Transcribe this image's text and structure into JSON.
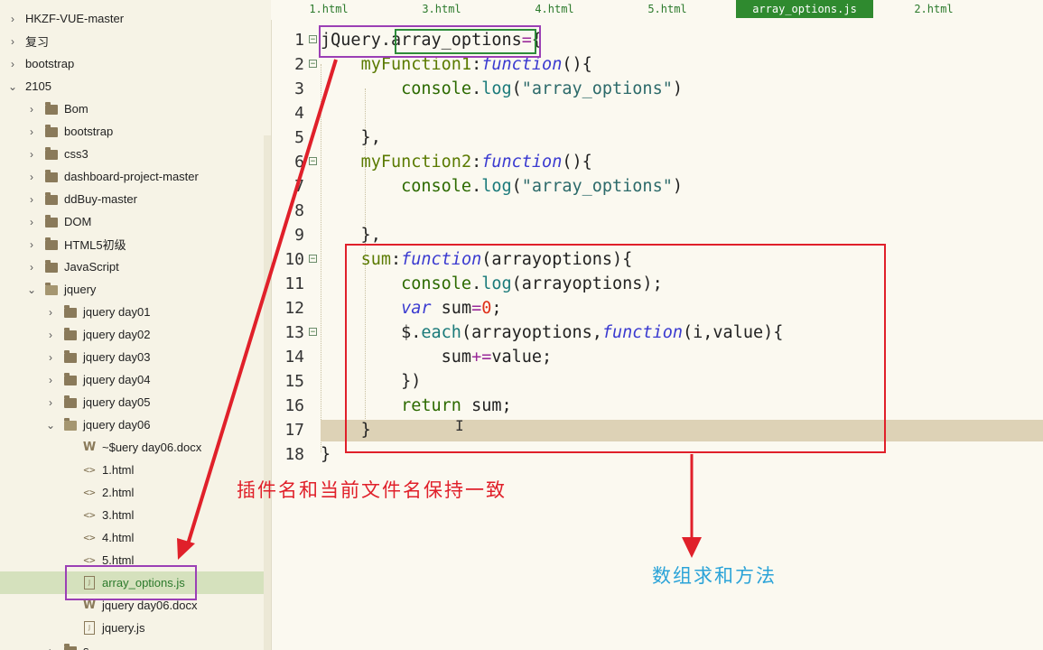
{
  "sidebar": {
    "items": [
      {
        "label": "HKZF-VUE-master",
        "depth": 0,
        "kind": "folder",
        "expanded": false
      },
      {
        "label": "复习",
        "depth": 0,
        "kind": "folder",
        "expanded": false
      },
      {
        "label": "bootstrap",
        "depth": 0,
        "kind": "folder",
        "expanded": false
      },
      {
        "label": "2105",
        "depth": 0,
        "kind": "folder",
        "expanded": true
      },
      {
        "label": "Bom",
        "depth": 1,
        "kind": "folder",
        "expanded": false
      },
      {
        "label": "bootstrap",
        "depth": 1,
        "kind": "folder",
        "expanded": false
      },
      {
        "label": "css3",
        "depth": 1,
        "kind": "folder",
        "expanded": false
      },
      {
        "label": "dashboard-project-master",
        "depth": 1,
        "kind": "folder",
        "expanded": false
      },
      {
        "label": "ddBuy-master",
        "depth": 1,
        "kind": "folder",
        "expanded": false
      },
      {
        "label": "DOM",
        "depth": 1,
        "kind": "folder",
        "expanded": false
      },
      {
        "label": "HTML5初级",
        "depth": 1,
        "kind": "folder",
        "expanded": false
      },
      {
        "label": "JavaScript",
        "depth": 1,
        "kind": "folder",
        "expanded": false
      },
      {
        "label": "jquery",
        "depth": 1,
        "kind": "folder",
        "expanded": true
      },
      {
        "label": "jquery day01",
        "depth": 2,
        "kind": "folder",
        "expanded": false
      },
      {
        "label": "jquery day02",
        "depth": 2,
        "kind": "folder",
        "expanded": false
      },
      {
        "label": "jquery day03",
        "depth": 2,
        "kind": "folder",
        "expanded": false
      },
      {
        "label": "jquery day04",
        "depth": 2,
        "kind": "folder",
        "expanded": false
      },
      {
        "label": "jquery day05",
        "depth": 2,
        "kind": "folder",
        "expanded": false
      },
      {
        "label": "jquery day06",
        "depth": 2,
        "kind": "folder",
        "expanded": true
      },
      {
        "label": "~$uery day06.docx",
        "depth": 3,
        "kind": "word"
      },
      {
        "label": "1.html",
        "depth": 3,
        "kind": "html"
      },
      {
        "label": "2.html",
        "depth": 3,
        "kind": "html"
      },
      {
        "label": "3.html",
        "depth": 3,
        "kind": "html"
      },
      {
        "label": "4.html",
        "depth": 3,
        "kind": "html"
      },
      {
        "label": "5.html",
        "depth": 3,
        "kind": "html"
      },
      {
        "label": "array_options.js",
        "depth": 3,
        "kind": "js",
        "active": true
      },
      {
        "label": "jquery day06.docx",
        "depth": 3,
        "kind": "word"
      },
      {
        "label": "jquery.js",
        "depth": 3,
        "kind": "js"
      },
      {
        "label": "s",
        "depth": 2,
        "kind": "folder",
        "expanded": false
      }
    ]
  },
  "tabs": [
    {
      "label": "1.html"
    },
    {
      "label": "3.html"
    },
    {
      "label": "4.html"
    },
    {
      "label": "5.html"
    },
    {
      "label": "array_options.js",
      "active": true
    },
    {
      "label": "2.html"
    }
  ],
  "code": {
    "lines": [
      {
        "n": "1",
        "fold": true,
        "tokens": [
          [
            "jQuery",
            "plain"
          ],
          [
            ".",
            "plain"
          ],
          [
            "array_options",
            "plain"
          ],
          [
            "=",
            "op"
          ],
          [
            "{",
            "plain"
          ]
        ]
      },
      {
        "n": "2",
        "fold": true,
        "tokens": [
          [
            "    ",
            "plain"
          ],
          [
            "myFunction1",
            "obj"
          ],
          [
            ":",
            "plain"
          ],
          [
            "function",
            "fn"
          ],
          [
            "(){",
            "plain"
          ]
        ]
      },
      {
        "n": "3",
        "fold": false,
        "tokens": [
          [
            "        ",
            "plain"
          ],
          [
            "console",
            "kw"
          ],
          [
            ".",
            "plain"
          ],
          [
            "log",
            "call"
          ],
          [
            "(",
            "plain"
          ],
          [
            "\"array_options\"",
            "str"
          ],
          [
            ")",
            "plain"
          ]
        ]
      },
      {
        "n": "4",
        "fold": false,
        "tokens": []
      },
      {
        "n": "5",
        "fold": false,
        "tokens": [
          [
            "    },",
            "plain"
          ]
        ]
      },
      {
        "n": "6",
        "fold": true,
        "tokens": [
          [
            "    ",
            "plain"
          ],
          [
            "myFunction2",
            "obj"
          ],
          [
            ":",
            "plain"
          ],
          [
            "function",
            "fn"
          ],
          [
            "(){",
            "plain"
          ]
        ]
      },
      {
        "n": "7",
        "fold": false,
        "tokens": [
          [
            "        ",
            "plain"
          ],
          [
            "console",
            "kw"
          ],
          [
            ".",
            "plain"
          ],
          [
            "log",
            "call"
          ],
          [
            "(",
            "plain"
          ],
          [
            "\"array_options\"",
            "str"
          ],
          [
            ")",
            "plain"
          ]
        ]
      },
      {
        "n": "8",
        "fold": false,
        "tokens": []
      },
      {
        "n": "9",
        "fold": false,
        "tokens": [
          [
            "    },",
            "plain"
          ]
        ]
      },
      {
        "n": "10",
        "fold": true,
        "tokens": [
          [
            "    ",
            "plain"
          ],
          [
            "sum",
            "obj"
          ],
          [
            ":",
            "plain"
          ],
          [
            "function",
            "fn"
          ],
          [
            "(arrayoptions){",
            "plain"
          ]
        ]
      },
      {
        "n": "11",
        "fold": false,
        "tokens": [
          [
            "        ",
            "plain"
          ],
          [
            "console",
            "kw"
          ],
          [
            ".",
            "plain"
          ],
          [
            "log",
            "call"
          ],
          [
            "(arrayoptions);",
            "plain"
          ]
        ]
      },
      {
        "n": "12",
        "fold": false,
        "tokens": [
          [
            "        ",
            "plain"
          ],
          [
            "var",
            "fn"
          ],
          [
            " sum",
            "plain"
          ],
          [
            "=",
            "op"
          ],
          [
            "0",
            "num"
          ],
          [
            ";",
            "plain"
          ]
        ]
      },
      {
        "n": "13",
        "fold": true,
        "tokens": [
          [
            "        ",
            "plain"
          ],
          [
            "$.",
            "plain"
          ],
          [
            "each",
            "call"
          ],
          [
            "(arrayoptions,",
            "plain"
          ],
          [
            "function",
            "fn"
          ],
          [
            "(i,value){",
            "plain"
          ]
        ]
      },
      {
        "n": "14",
        "fold": false,
        "tokens": [
          [
            "            ",
            "plain"
          ],
          [
            "sum",
            "plain"
          ],
          [
            "+=",
            "op"
          ],
          [
            "value;",
            "plain"
          ]
        ]
      },
      {
        "n": "15",
        "fold": false,
        "tokens": [
          [
            "        ",
            "plain"
          ],
          [
            "})",
            "plain"
          ]
        ]
      },
      {
        "n": "16",
        "fold": false,
        "tokens": [
          [
            "        ",
            "plain"
          ],
          [
            "return",
            "kw"
          ],
          [
            " sum;",
            "plain"
          ]
        ]
      },
      {
        "n": "17",
        "fold": false,
        "highlight": true,
        "tokens": [
          [
            "    ",
            "plain"
          ],
          [
            "}",
            "plain"
          ]
        ]
      },
      {
        "n": "18",
        "fold": false,
        "tokens": [
          [
            "}",
            "plain"
          ]
        ]
      }
    ]
  },
  "annotations": {
    "plugin_note": "插件名和当前文件名保持一致",
    "sum_note": "数组求和方法"
  },
  "colors": {
    "purple_box": "#9b3fb5",
    "green_box": "#2e8b3a",
    "red_box": "#e0202a",
    "red_text": "#e0202a",
    "blue_text": "#2aa3d8",
    "active_tab": "#2f8a2f",
    "active_row": "#d5e1bd"
  }
}
